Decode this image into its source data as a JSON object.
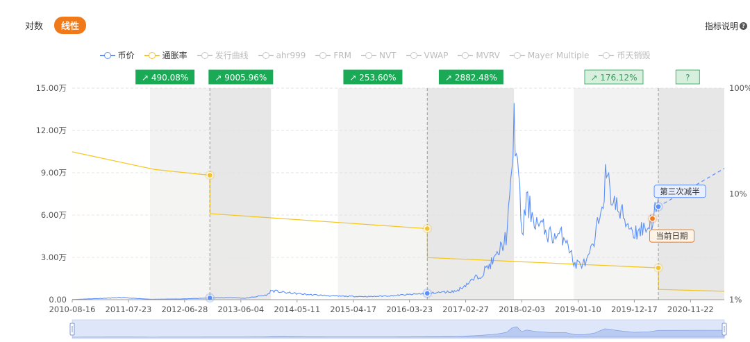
{
  "scale_toggle": {
    "log_label": "对数",
    "linear_label": "线性",
    "selected": "linear"
  },
  "help": {
    "label": "指标说明",
    "icon": "help-icon"
  },
  "colors": {
    "price": "#5b8ff9",
    "inflation": "#f2c234",
    "accent": "#f07a1a",
    "badge": "#1aaa55",
    "disabled": "#c8c8c8"
  },
  "legend": [
    {
      "name": "price",
      "label": "币价",
      "active": true
    },
    {
      "name": "inflation",
      "label": "通胀率",
      "active": true
    },
    {
      "name": "issuance",
      "label": "发行曲线",
      "active": false
    },
    {
      "name": "ahr999",
      "label": "ahr999",
      "active": false
    },
    {
      "name": "frm",
      "label": "FRM",
      "active": false
    },
    {
      "name": "nvt",
      "label": "NVT",
      "active": false
    },
    {
      "name": "vwap",
      "label": "VWAP",
      "active": false
    },
    {
      "name": "mvrv",
      "label": "MVRV",
      "active": false
    },
    {
      "name": "mayer",
      "label": "Mayer Multiple",
      "active": false
    },
    {
      "name": "coindays",
      "label": "币天销毁",
      "active": false
    }
  ],
  "chart_data": {
    "type": "line",
    "x_ticks": [
      "2010-08-16",
      "2011-07-23",
      "2012-06-28",
      "2013-06-04",
      "2014-05-11",
      "2015-04-17",
      "2016-03-23",
      "2017-02-27",
      "2018-02-03",
      "2019-01-10",
      "2019-12-17",
      "2020-11-22"
    ],
    "xlim": [
      "2010-08-16",
      "2021-06-15"
    ],
    "y_left": {
      "ticks": [
        "0.00",
        "3.00万",
        "6.00万",
        "9.00万",
        "12.00万",
        "15.00万"
      ],
      "lim": [
        0,
        150000
      ]
    },
    "y_right": {
      "ticks": [
        "1%",
        "10%",
        "100%"
      ],
      "scale": "log",
      "lim": [
        1,
        100
      ]
    },
    "grid": "horizontal dashed",
    "legend_position": "top-center",
    "series": [
      {
        "name": "币价",
        "axis": "left",
        "x": [
          "2010-08-16",
          "2011-06-08",
          "2011-12-01",
          "2012-06-01",
          "2012-11-28",
          "2013-04-10",
          "2013-07-01",
          "2013-11-15",
          "2013-12-04",
          "2014-03-01",
          "2014-08-01",
          "2015-01-14",
          "2015-08-01",
          "2016-01-01",
          "2016-07-09",
          "2017-01-01",
          "2017-06-01",
          "2017-09-01",
          "2017-11-01",
          "2017-12-01",
          "2017-12-17",
          "2018-01-10",
          "2018-02-06",
          "2018-03-01",
          "2018-05-01",
          "2018-08-01",
          "2018-11-01",
          "2018-12-15",
          "2019-03-01",
          "2019-04-20",
          "2019-06-26",
          "2019-09-01",
          "2019-12-15",
          "2020-03-13",
          "2020-05-11"
        ],
        "values": [
          100,
          1500,
          300,
          500,
          1200,
          1500,
          1000,
          3500,
          6500,
          5000,
          3500,
          2500,
          2200,
          3000,
          4500,
          6000,
          18000,
          30000,
          45000,
          80000,
          129000,
          90000,
          45000,
          70000,
          55000,
          45000,
          45000,
          25000,
          26000,
          40000,
          86000,
          65000,
          48000,
          52000,
          66000
        ]
      },
      {
        "name": "通胀率",
        "axis": "right",
        "x": [
          "2010-08-16",
          "2011-06-01",
          "2012-01-01",
          "2012-11-28",
          "2012-11-29",
          "2016-07-09",
          "2016-07-10",
          "2020-05-11",
          "2020-05-12",
          "2021-06-15"
        ],
        "values": [
          25,
          20,
          17,
          15,
          6.5,
          4.7,
          2.5,
          2.0,
          1.25,
          1.2
        ]
      }
    ],
    "halving_events": [
      {
        "date": "2012-11-28",
        "label": ""
      },
      {
        "date": "2016-07-09",
        "label": ""
      },
      {
        "date": "2020-05-11",
        "label": "第三次减半"
      }
    ],
    "current_date": {
      "date": "2020-04-05",
      "label": "当前日期"
    },
    "forecast": {
      "from": "2020-05-11",
      "to": "2021-06-15"
    },
    "period_badges": [
      {
        "text": "490.08%",
        "center": "2012-03-01",
        "style": "solid"
      },
      {
        "text": "9005.96%",
        "center": "2013-06-04",
        "style": "solid"
      },
      {
        "text": "253.60%",
        "center": "2015-08-14",
        "style": "solid"
      },
      {
        "text": "2882.48%",
        "center": "2017-04-01",
        "style": "solid"
      },
      {
        "text": "176.12%",
        "center": "2019-08-15",
        "style": "outline"
      },
      {
        "text": "?",
        "center": "2020-11-05",
        "style": "outline"
      }
    ],
    "shaded_bands": [
      {
        "from": "2011-12-01",
        "to": "2012-11-28",
        "shade": "light"
      },
      {
        "from": "2012-11-28",
        "to": "2013-12-04",
        "shade": "dark"
      },
      {
        "from": "2015-01-14",
        "to": "2016-07-09",
        "shade": "light"
      },
      {
        "from": "2016-07-09",
        "to": "2017-12-17",
        "shade": "dark"
      },
      {
        "from": "2018-12-15",
        "to": "2020-05-11",
        "shade": "light"
      },
      {
        "from": "2020-05-11",
        "to": "2021-06-15",
        "shade": "dark"
      }
    ]
  }
}
